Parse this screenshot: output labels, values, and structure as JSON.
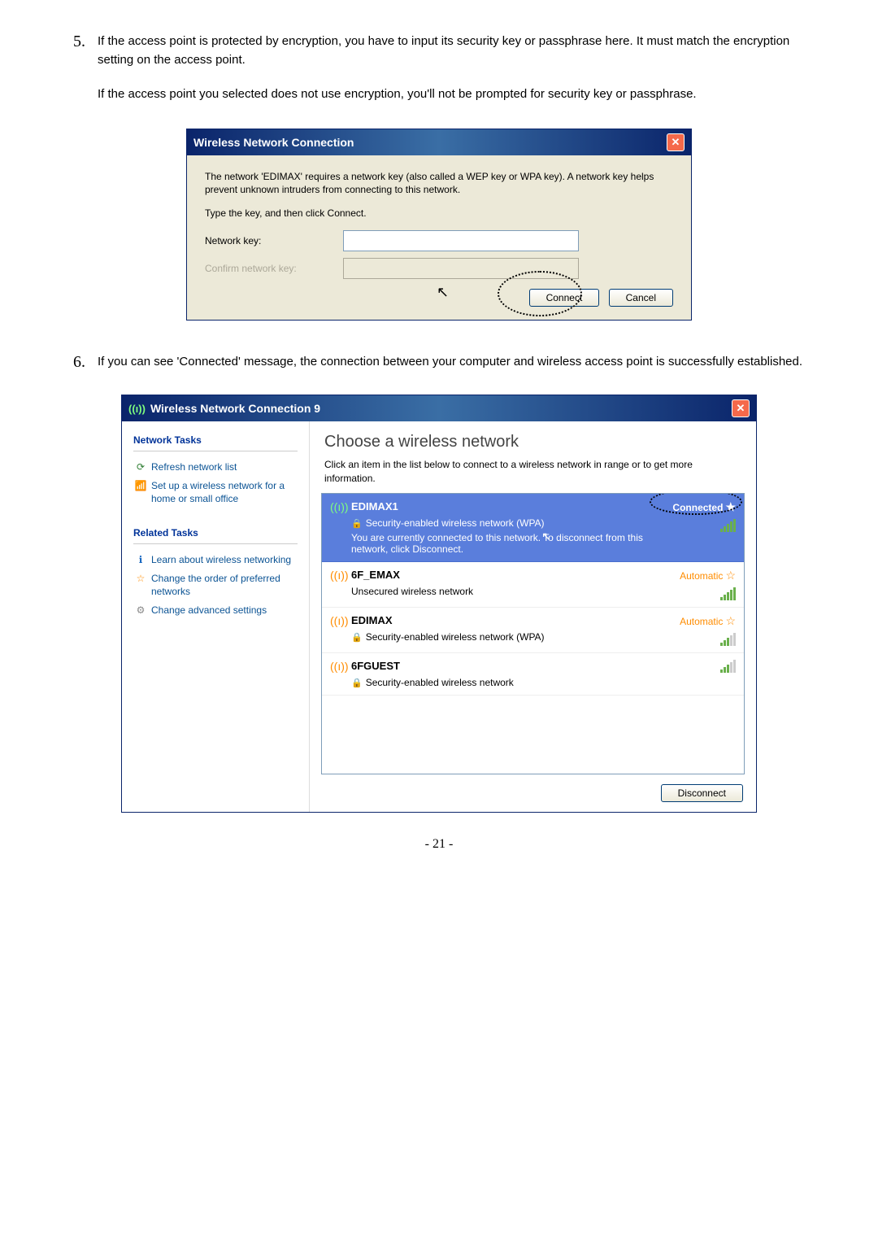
{
  "step5": {
    "num": "5.",
    "text": "If the access point is protected by encryption, you have to input its security key or passphrase here. It must match the encryption setting on the access point.",
    "sub": "If the access point you selected does not use encryption, you'll not be prompted for security key or passphrase."
  },
  "dialog1": {
    "title": "Wireless Network Connection",
    "desc": "The network 'EDIMAX' requires a network key (also called a WEP key or WPA key). A network key helps prevent unknown intruders from connecting to this network.",
    "instruction": "Type the key, and then click Connect.",
    "field1_label": "Network key:",
    "field2_label": "Confirm network key:",
    "connect": "Connect",
    "cancel": "Cancel"
  },
  "step6": {
    "num": "6.",
    "text": "If you can see 'Connected' message, the connection between your computer and wireless access point is successfully established."
  },
  "dialog2": {
    "title": "Wireless Network Connection 9",
    "left": {
      "section1_title": "Network Tasks",
      "refresh": "Refresh network list",
      "setup": "Set up a wireless network for a home or small office",
      "section2_title": "Related Tasks",
      "learn": "Learn about wireless networking",
      "reorder": "Change the order of preferred networks",
      "advanced": "Change advanced settings"
    },
    "right": {
      "header": "Choose a wireless network",
      "desc": "Click an item in the list below to connect to a wireless network in range or to get more information.",
      "networks": [
        {
          "name": "EDIMAX1",
          "sub": "Security-enabled wireless network (WPA)",
          "status": "Connected",
          "connected": true,
          "msg": "You are currently connected to this network. To disconnect from this network, click Disconnect."
        },
        {
          "name": "6F_EMAX",
          "sub": "Unsecured wireless network",
          "status": "Automatic"
        },
        {
          "name": "EDIMAX",
          "sub": "Security-enabled wireless network (WPA)",
          "status": "Automatic"
        },
        {
          "name": "6FGUEST",
          "sub": "Security-enabled wireless network",
          "status": ""
        }
      ],
      "disconnect": "Disconnect"
    }
  },
  "pagenum": "- 21 -"
}
